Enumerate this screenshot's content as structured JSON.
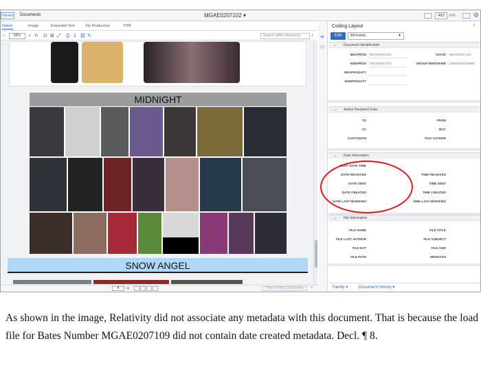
{
  "topbar": {
    "viewer_label": "Viewer",
    "documents_label": "Documents",
    "doc_title": "MGAE0207102 ▾",
    "page_value": "453",
    "page_total": "/649"
  },
  "tabs": [
    "Native",
    "Image",
    "Extracted Text",
    "No Production",
    "PDF"
  ],
  "toolbar": {
    "zoom": "59%",
    "search_placeholder": "Search within Document"
  },
  "viewer": {
    "board_title": "MIDNIGHT",
    "snow_title": "SNOW ANGEL"
  },
  "bottombar": {
    "page_value": "8",
    "page_total": "/8",
    "similar_label": "View Similar Documents"
  },
  "panel": {
    "title": "Coding Layout",
    "edit_label": "Edit",
    "fields_select": "All Fields",
    "sections": {
      "doc_id": {
        "title": "Document Identification",
        "begprod": "BEGPROD",
        "begprod_val": "MGAE0207102",
        "docid": "DOCID",
        "docid_val": "MGAE0207102",
        "endprod": "ENDPROD",
        "endprod_val": "MGAE0207110",
        "group_identifier": "GROUP IDENTIFIER",
        "group_val": "DMG0002133896",
        "begprodatt": "BEGPRODATT",
        "endprodatt": "ENDPRODATT"
      },
      "author": {
        "title": "Author Recipient Data",
        "to": "TO",
        "from": "FROM",
        "cc": "CC",
        "bcc": "BCC",
        "custodian": "CUSTODIAN",
        "file_author": "FILE AUTHOR"
      },
      "date": {
        "title": "Date Information",
        "sort_date_time": "SORT DATE TIME",
        "date_received": "DATE RECEIVED",
        "time_received": "TIME RECEIVED",
        "date_sent": "DATE SENT",
        "time_sent": "TIME SENT",
        "date_created": "DATE CREATED",
        "time_created": "TIME CREATED",
        "date_last_modified": "DATE LAST MODIFIED",
        "time_last_modified": "TIME LAST MODIFIED"
      },
      "file": {
        "title": "File Information",
        "file_name": "FILE NAME",
        "file_title": "FILE TITLE",
        "file_last_author": "FILE LAST AUTHOR",
        "file_subject": "FILE SUBJECT",
        "file_ext": "FILE EXT",
        "file_size": "FILE SIZE",
        "file_path": "FILE PATH",
        "md5hash": "MD5HASH"
      }
    },
    "bottom": {
      "family": "Family ▾",
      "history": "Document History ▾"
    }
  },
  "caption": {
    "line1": "As shown in the image, Relativity did not associate any metadata with this document. That is because the load file for Bates Number MGAE0207109 did not contain date created metadata. Decl. ¶ 8."
  }
}
